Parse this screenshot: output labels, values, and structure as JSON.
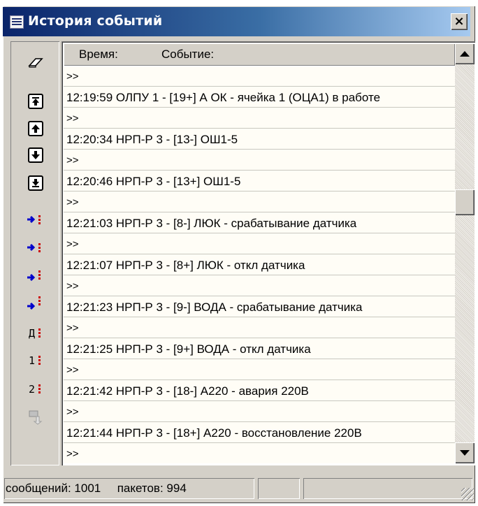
{
  "window": {
    "title": "История событий",
    "close_glyph": "×"
  },
  "toolbar": {
    "buttons": [
      {
        "icon": "eraser-icon"
      },
      {
        "icon": "scroll-to-top-icon"
      },
      {
        "icon": "arrow-up-icon"
      },
      {
        "icon": "arrow-down-icon"
      },
      {
        "icon": "scroll-to-bottom-icon"
      },
      {
        "icon": "goto-event-icon"
      },
      {
        "icon": "goto-event-icon"
      },
      {
        "icon": "goto-event-icon"
      },
      {
        "icon": "goto-event-icon"
      },
      {
        "icon": "filter-d-icon",
        "label": "Д"
      },
      {
        "icon": "filter-1-icon",
        "label": "1"
      },
      {
        "icon": "filter-2-icon",
        "label": "2"
      },
      {
        "icon": "disabled-arrow-icon"
      }
    ]
  },
  "list": {
    "columns": {
      "time": "Время:",
      "event": "Событие:"
    },
    "rows": [
      ">>",
      "12:19:59  ОЛПУ  1 - [19+] А ОК - ячейка 1 (ОЦА1) в работе",
      ">>",
      "12:20:34  НРП-Р  3 - [13-] ОШ1-5",
      ">>",
      "12:20:46  НРП-Р  3 - [13+] ОШ1-5",
      ">>",
      "12:21:03  НРП-Р  3 - [8-] ЛЮК - срабатывание датчика",
      ">>",
      "12:21:07  НРП-Р  3 - [8+] ЛЮК - откл датчика",
      ">>",
      "12:21:23  НРП-Р  3 - [9-] ВОДА - срабатывание датчика",
      ">>",
      "12:21:25  НРП-Р  3 - [9+] ВОДА - откл датчика",
      ">>",
      "12:21:42  НРП-Р  3 - [18-] А220 - авария 220В",
      ">>",
      "12:21:44  НРП-Р  3 - [18+] А220 - восстановление 220В",
      ">>"
    ],
    "scroll_position": 0.33
  },
  "status": {
    "messages": "сообщений: 1001",
    "packets": "пакетов: 994"
  },
  "colors": {
    "title_start": "#0a246a",
    "title_end": "#a6caf0",
    "face": "#d4d0c8",
    "red_marker": "#cc0000",
    "blue_arrow": "#0000cc"
  }
}
